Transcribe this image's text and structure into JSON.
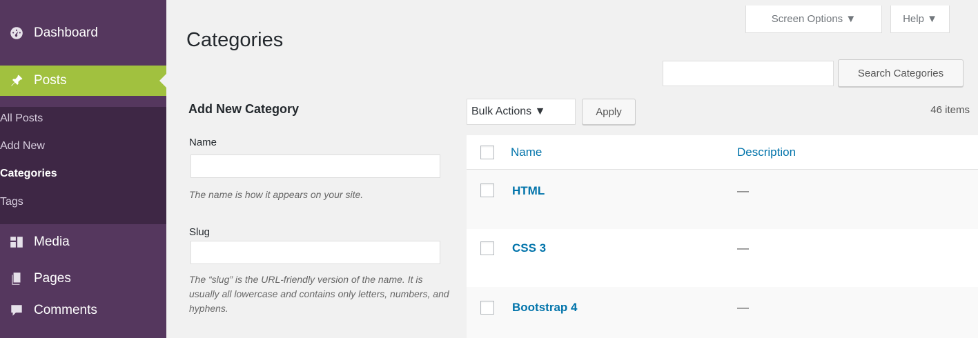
{
  "sidebar": {
    "dashboard": {
      "label": "Dashboard",
      "icon": "dashboard-icon"
    },
    "posts": {
      "label": "Posts",
      "icon": "pin-icon"
    },
    "submenu": [
      "All Posts",
      "Add New",
      "Categories",
      "Tags"
    ],
    "media": {
      "label": "Media",
      "icon": "media-icon"
    },
    "pages": {
      "label": "Pages",
      "icon": "pages-icon"
    },
    "comments": {
      "label": "Comments",
      "icon": "comment-icon"
    }
  },
  "header": {
    "title": "Categories",
    "screen_options": "Screen Options ▼",
    "help": "Help ▼"
  },
  "search": {
    "value": "",
    "button": "Search Categories"
  },
  "form": {
    "heading": "Add New Category",
    "name_label": "Name",
    "name_value": "",
    "name_desc": "The name is how it appears on your site.",
    "slug_label": "Slug",
    "slug_value": "",
    "slug_desc": "The “slug” is the URL-friendly version of the name. It is usually all lowercase and contains only letters, numbers, and hyphens."
  },
  "table": {
    "bulk_actions": "Bulk Actions ▼",
    "apply": "Apply",
    "items_count": "46 items",
    "columns": [
      "Name",
      "Description"
    ],
    "rows": [
      {
        "name": "HTML",
        "description": "—"
      },
      {
        "name": "CSS 3",
        "description": "—"
      },
      {
        "name": "Bootstrap 4",
        "description": "—"
      }
    ]
  },
  "colors": {
    "sidebar_bg": "#55375e",
    "submenu_bg": "#3e2745",
    "active": "#a1c13f",
    "link": "#0073aa"
  }
}
